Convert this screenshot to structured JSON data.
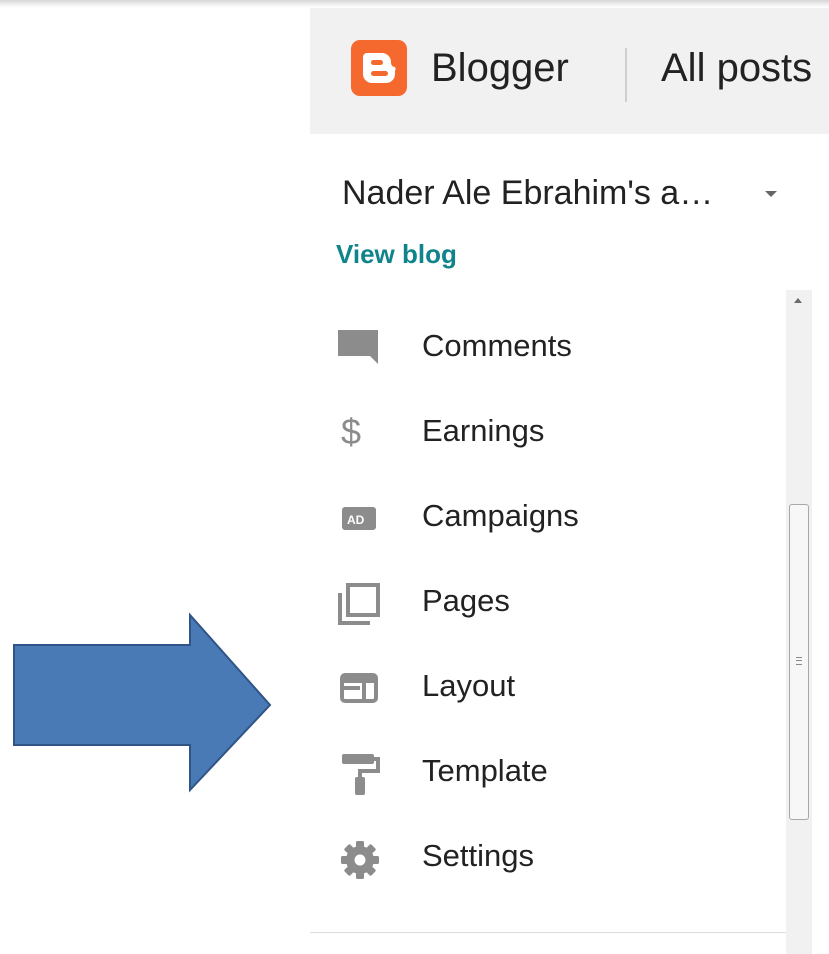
{
  "header": {
    "brand": "Blogger",
    "section_title": "All posts"
  },
  "blog_selector": {
    "selected": "Nader Ale Ebrahim's a…"
  },
  "view_blog_label": "View blog",
  "nav": {
    "items": [
      {
        "label": "Comments",
        "icon": "comment-icon"
      },
      {
        "label": "Earnings",
        "icon": "dollar-icon"
      },
      {
        "label": "Campaigns",
        "icon": "ad-icon"
      },
      {
        "label": "Pages",
        "icon": "pages-icon"
      },
      {
        "label": "Layout",
        "icon": "layout-icon"
      },
      {
        "label": "Template",
        "icon": "paint-roller-icon"
      },
      {
        "label": "Settings",
        "icon": "gear-icon"
      }
    ]
  },
  "colors": {
    "brand_orange": "#f5692f",
    "link_teal": "#10848b",
    "icon_gray": "#8c8c8c",
    "arrow_fill": "#4a7ab6",
    "arrow_stroke": "#2f5487"
  }
}
